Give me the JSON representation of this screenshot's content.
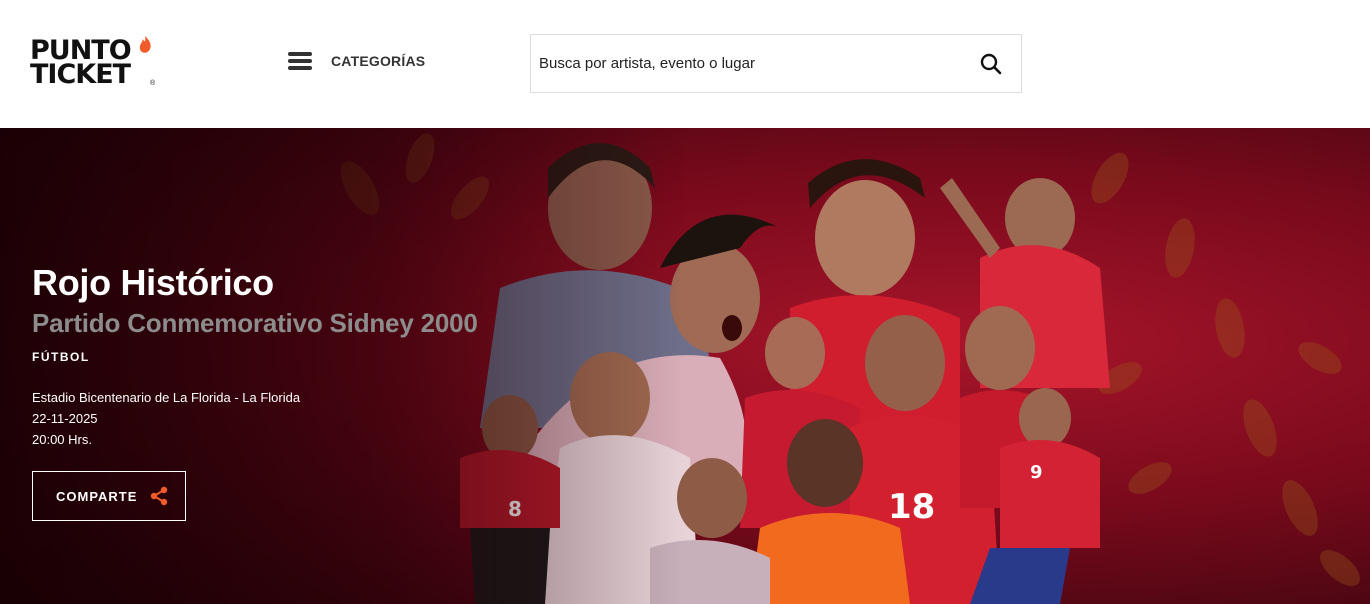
{
  "header": {
    "logo_line1": "PUNTO",
    "logo_line2": "TICKET",
    "logo_reg": "®",
    "categories_label": "CATEGORÍAS",
    "search_placeholder": "Busca por artista, evento o lugar"
  },
  "event": {
    "title": "Rojo Histórico",
    "subtitle": "Partido Conmemorativo Sidney 2000",
    "category": "FÚTBOL",
    "venue": "Estadio Bicentenario de La Florida - La Florida",
    "date": "22-11-2025",
    "time": "20:00 Hrs.",
    "share_label": "COMPARTE",
    "jersey_numbers": [
      "8",
      "18",
      "9"
    ]
  },
  "colors": {
    "brand_accent": "#f25c2a",
    "hero_red": "#7a0a1c",
    "subtitle_gray": "#8c8c8c"
  }
}
